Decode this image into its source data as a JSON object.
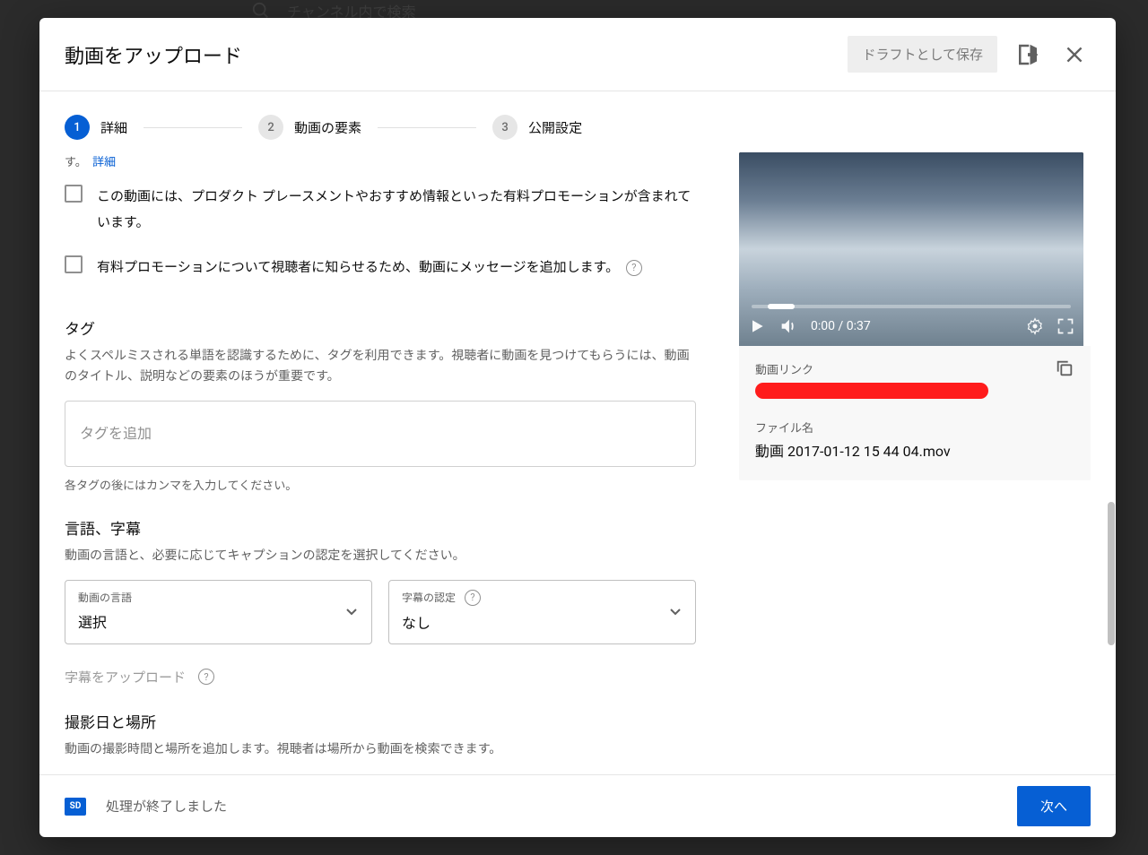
{
  "background": {
    "search_placeholder": "チャンネル内で検索"
  },
  "dialog": {
    "title": "動画をアップロード",
    "save_draft_label": "ドラフトとして保存",
    "steps": [
      {
        "num": "1",
        "label": "詳細"
      },
      {
        "num": "2",
        "label": "動画の要素"
      },
      {
        "num": "3",
        "label": "公開設定"
      }
    ],
    "scroll_hint_prefix": "す。",
    "scroll_hint_link": "詳細",
    "checks": {
      "paid_promo": "この動画には、プロダクト プレースメントやおすすめ情報といった有料プロモーションが含まれています。",
      "paid_promo_notify": "有料プロモーションについて視聴者に知らせるため、動画にメッセージを追加します。"
    },
    "tags": {
      "title": "タグ",
      "desc": "よくスペルミスされる単語を認識するために、タグを利用できます。視聴者に動画を見つけてもらうには、動画のタイトル、説明などの要素のほうが重要です。",
      "placeholder": "タグを追加",
      "hint": "各タグの後にはカンマを入力してください。"
    },
    "lang": {
      "title": "言語、字幕",
      "desc": "動画の言語と、必要に応じてキャプションの認定を選択してください。",
      "video_lang_label": "動画の言語",
      "video_lang_value": "選択",
      "caption_cert_label": "字幕の認定",
      "caption_cert_value": "なし",
      "upload_subtitles": "字幕をアップロード"
    },
    "date_loc": {
      "title": "撮影日と場所",
      "desc": "動画の撮影時間と場所を追加します。視聴者は場所から動画を検索できます。"
    }
  },
  "preview": {
    "time": "0:00 / 0:37",
    "link_label": "動画リンク",
    "file_label": "ファイル名",
    "file_name": "動画 2017-01-12 15 44 04.mov"
  },
  "footer": {
    "sd": "SD",
    "status": "処理が終了しました",
    "next": "次へ"
  }
}
